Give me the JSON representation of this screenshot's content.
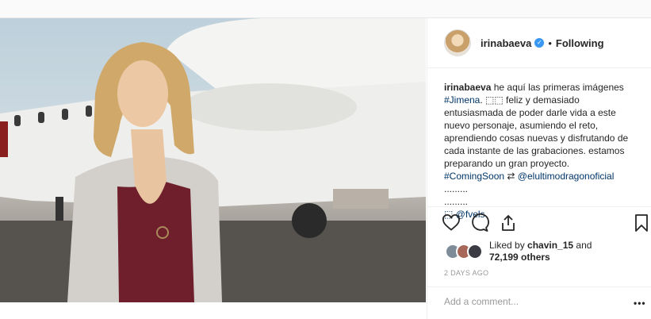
{
  "post": {
    "username": "irinabaeva",
    "dot": "•",
    "follow_status": "Following",
    "caption": {
      "username": "irinabaeva",
      "line1_rest": " he aquí las primeras imágenes",
      "line2_tag": "#Jimena",
      "line2_rest": ". ⬚⬚ feliz y demasiado",
      "line3": "entusiasmada de poder darle vida a este",
      "line4": "nuevo personaje, asumiendo el reto,",
      "line5": "aprendiendo cosas nuevas y disfrutando de",
      "line6": "cada instante de las grabaciones. estamos",
      "line7": "preparando un gran proyecto.",
      "line8_tag": "#ComingSoon",
      "line8_mid": " ⇄ ",
      "line8_mention": "@elultimodragonoficial",
      "line9": ".........",
      "line10": ".........",
      "line11_glyph": "⬚ ",
      "line11_mention": "@fvels"
    },
    "icons": [
      "heart-icon",
      "comment-icon",
      "share-icon",
      "bookmark-icon"
    ],
    "likes": {
      "prefix": "Liked by ",
      "user": "chavin_15",
      "and": " and",
      "count": "72,199 others"
    },
    "timestamp": "2 DAYS AGO",
    "comment_placeholder": "Add a comment...",
    "more_label": "•••"
  },
  "colors": {
    "accent": "#3897f0",
    "link": "#003569",
    "muted": "#999999"
  }
}
